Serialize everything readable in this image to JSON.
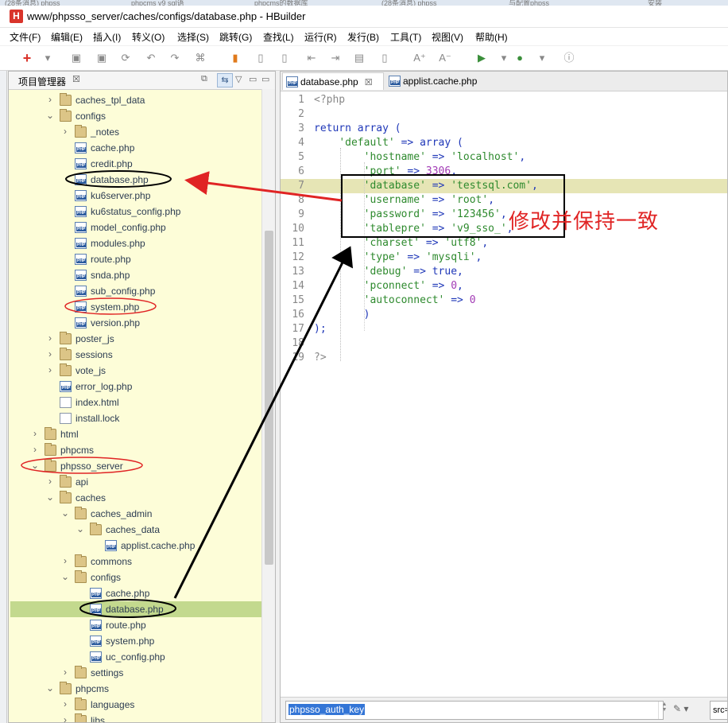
{
  "browser_tabs": [
    "(28条消息) phpss",
    "phpcms v9 sql语",
    "phpcms的数据库",
    "(28条消息) phpss",
    "与配置phpss",
    "安装"
  ],
  "window": {
    "logo": "H",
    "title": "www/phpsso_server/caches/configs/database.php  -  HBuilder"
  },
  "menu": [
    "文件(F)",
    "编辑(E)",
    "插入(I)",
    "转义(O)",
    "选择(S)",
    "跳转(G)",
    "查找(L)",
    "运行(R)",
    "发行(B)",
    "工具(T)",
    "视图(V)",
    "帮助(H)"
  ],
  "toolbar": {
    "icons": [
      "add-icon",
      "dropdown-icon",
      "save-icon",
      "save-all-icon",
      "refresh-icon",
      "undo-icon",
      "redo-icon",
      "format-icon",
      "bookmark-icon",
      "doc-icon",
      "doc-icon",
      "indent-left-icon",
      "indent-right-icon",
      "terminal-icon",
      "doc-icon",
      "font-increase-icon",
      "font-decrease-icon",
      "run-icon",
      "dropdown-icon",
      "chrome-icon",
      "dropdown-icon",
      "info-icon"
    ]
  },
  "project_panel": {
    "title": "项目管理器",
    "close": "☒",
    "tree": [
      {
        "label": "caches_tpl_data",
        "type": "folder",
        "depth": 1,
        "arrow": "›"
      },
      {
        "label": "configs",
        "type": "folder",
        "depth": 1,
        "arrow": "⌄"
      },
      {
        "label": "_notes",
        "type": "folder",
        "depth": 2,
        "arrow": "›"
      },
      {
        "label": "cache.php",
        "type": "php",
        "depth": 2,
        "arrow": ""
      },
      {
        "label": "credit.php",
        "type": "php",
        "depth": 2,
        "arrow": ""
      },
      {
        "label": "database.php",
        "type": "php",
        "depth": 2,
        "arrow": ""
      },
      {
        "label": "ku6server.php",
        "type": "php",
        "depth": 2,
        "arrow": ""
      },
      {
        "label": "ku6status_config.php",
        "type": "php",
        "depth": 2,
        "arrow": ""
      },
      {
        "label": "model_config.php",
        "type": "php",
        "depth": 2,
        "arrow": ""
      },
      {
        "label": "modules.php",
        "type": "php",
        "depth": 2,
        "arrow": ""
      },
      {
        "label": "route.php",
        "type": "php",
        "depth": 2,
        "arrow": ""
      },
      {
        "label": "snda.php",
        "type": "php",
        "depth": 2,
        "arrow": ""
      },
      {
        "label": "sub_config.php",
        "type": "php",
        "depth": 2,
        "arrow": ""
      },
      {
        "label": "system.php",
        "type": "php",
        "depth": 2,
        "arrow": ""
      },
      {
        "label": "version.php",
        "type": "php",
        "depth": 2,
        "arrow": ""
      },
      {
        "label": "poster_js",
        "type": "folder",
        "depth": 1,
        "arrow": "›"
      },
      {
        "label": "sessions",
        "type": "folder",
        "depth": 1,
        "arrow": "›"
      },
      {
        "label": "vote_js",
        "type": "folder",
        "depth": 1,
        "arrow": "›"
      },
      {
        "label": "error_log.php",
        "type": "php",
        "depth": 1,
        "arrow": ""
      },
      {
        "label": "index.html",
        "type": "doc",
        "depth": 1,
        "arrow": ""
      },
      {
        "label": "install.lock",
        "type": "doc",
        "depth": 1,
        "arrow": ""
      },
      {
        "label": "html",
        "type": "folder",
        "depth": 0,
        "arrow": "›"
      },
      {
        "label": "phpcms",
        "type": "folder",
        "depth": 0,
        "arrow": "›"
      },
      {
        "label": "phpsso_server",
        "type": "folder",
        "depth": 0,
        "arrow": "⌄"
      },
      {
        "label": "api",
        "type": "folder",
        "depth": 1,
        "arrow": "›"
      },
      {
        "label": "caches",
        "type": "folder",
        "depth": 1,
        "arrow": "⌄"
      },
      {
        "label": "caches_admin",
        "type": "folder",
        "depth": 2,
        "arrow": "⌄"
      },
      {
        "label": "caches_data",
        "type": "folder",
        "depth": 3,
        "arrow": "⌄"
      },
      {
        "label": "applist.cache.php",
        "type": "php",
        "depth": 4,
        "arrow": ""
      },
      {
        "label": "commons",
        "type": "folder",
        "depth": 2,
        "arrow": "›"
      },
      {
        "label": "configs",
        "type": "folder",
        "depth": 2,
        "arrow": "⌄"
      },
      {
        "label": "cache.php",
        "type": "php",
        "depth": 3,
        "arrow": ""
      },
      {
        "label": "database.php",
        "type": "php",
        "depth": 3,
        "arrow": "",
        "selected": true
      },
      {
        "label": "route.php",
        "type": "php",
        "depth": 3,
        "arrow": ""
      },
      {
        "label": "system.php",
        "type": "php",
        "depth": 3,
        "arrow": ""
      },
      {
        "label": "uc_config.php",
        "type": "php",
        "depth": 3,
        "arrow": ""
      },
      {
        "label": "settings",
        "type": "folder",
        "depth": 2,
        "arrow": "›"
      },
      {
        "label": "phpcms",
        "type": "folder",
        "depth": 1,
        "arrow": "⌄"
      },
      {
        "label": "languages",
        "type": "folder",
        "depth": 2,
        "arrow": "›"
      },
      {
        "label": "libs",
        "type": "folder",
        "depth": 2,
        "arrow": "›"
      }
    ]
  },
  "editor": {
    "tabs": [
      {
        "label": "database.php",
        "close": "☒",
        "active": true
      },
      {
        "label": "applist.cache.php",
        "close": "",
        "active": false
      }
    ],
    "highlight_line": 7,
    "lines": [
      [
        [
          "c",
          "<?php"
        ]
      ],
      [],
      [
        [
          "k",
          "return array"
        ],
        [
          "o",
          " ("
        ]
      ],
      [
        [
          "t",
          "    "
        ],
        [
          "s",
          "'default'"
        ],
        [
          "o",
          " => "
        ],
        [
          "k",
          "array"
        ],
        [
          "o",
          " ("
        ]
      ],
      [
        [
          "t",
          "        "
        ],
        [
          "s",
          "'hostname'"
        ],
        [
          "o",
          " => "
        ],
        [
          "s",
          "'localhost'"
        ],
        [
          "o",
          ","
        ]
      ],
      [
        [
          "t",
          "        "
        ],
        [
          "s",
          "'port'"
        ],
        [
          "o",
          " => "
        ],
        [
          "n",
          "3306"
        ],
        [
          "o",
          ","
        ]
      ],
      [
        [
          "t",
          "        "
        ],
        [
          "s",
          "'database'"
        ],
        [
          "o",
          " => "
        ],
        [
          "s",
          "'testsql.com'"
        ],
        [
          "o",
          ","
        ]
      ],
      [
        [
          "t",
          "        "
        ],
        [
          "s",
          "'username'"
        ],
        [
          "o",
          " => "
        ],
        [
          "s",
          "'root'"
        ],
        [
          "o",
          ","
        ]
      ],
      [
        [
          "t",
          "        "
        ],
        [
          "s",
          "'password'"
        ],
        [
          "o",
          " => "
        ],
        [
          "s",
          "'123456'"
        ],
        [
          "o",
          ","
        ]
      ],
      [
        [
          "t",
          "        "
        ],
        [
          "s",
          "'tablepre'"
        ],
        [
          "o",
          " => "
        ],
        [
          "s",
          "'v9_sso_'"
        ],
        [
          "o",
          ","
        ]
      ],
      [
        [
          "t",
          "        "
        ],
        [
          "s",
          "'charset'"
        ],
        [
          "o",
          " => "
        ],
        [
          "s",
          "'utf8'"
        ],
        [
          "o",
          ","
        ]
      ],
      [
        [
          "t",
          "        "
        ],
        [
          "s",
          "'type'"
        ],
        [
          "o",
          " => "
        ],
        [
          "s",
          "'mysqli'"
        ],
        [
          "o",
          ","
        ]
      ],
      [
        [
          "t",
          "        "
        ],
        [
          "s",
          "'debug'"
        ],
        [
          "o",
          " => "
        ],
        [
          "k",
          "true"
        ],
        [
          "o",
          ","
        ]
      ],
      [
        [
          "t",
          "        "
        ],
        [
          "s",
          "'pconnect'"
        ],
        [
          "o",
          " => "
        ],
        [
          "n",
          "0"
        ],
        [
          "o",
          ","
        ]
      ],
      [
        [
          "t",
          "        "
        ],
        [
          "s",
          "'autoconnect'"
        ],
        [
          "o",
          " => "
        ],
        [
          "n",
          "0"
        ]
      ],
      [
        [
          "t",
          "        "
        ],
        [
          "o",
          ")"
        ]
      ],
      [
        [
          "o",
          ");"
        ]
      ],
      [],
      [
        [
          "c",
          "?>"
        ]
      ]
    ]
  },
  "find_bar": {
    "value": "phpsso_auth_key",
    "src_placeholder": "src="
  },
  "annotation": {
    "text": "修改并保持一致",
    "color": "#e02424"
  }
}
